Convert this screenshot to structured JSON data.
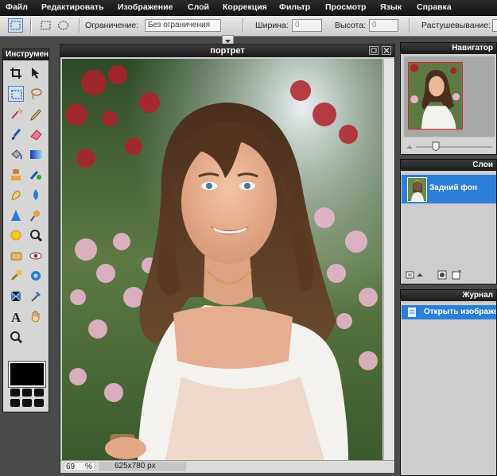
{
  "menu": {
    "items": [
      "Файл",
      "Редактировать",
      "Изображение",
      "Слой",
      "Коррекция",
      "Фильтр",
      "Просмотр",
      "Язык",
      "Справка"
    ]
  },
  "options_bar": {
    "constraint_label": "Ограничение:",
    "constraint_value": "Без ограничения",
    "width_label": "Ширина:",
    "width_value": "0",
    "height_label": "Высота:",
    "height_value": "0",
    "feather_label": "Растушевывание:"
  },
  "tools_panel": {
    "title": "Инструменты",
    "icons": [
      "crop-icon",
      "move-icon",
      "marquee-icon",
      "lasso-icon",
      "magic-wand-icon",
      "pencil-icon",
      "brush-icon",
      "eraser-icon",
      "paint-bucket-icon",
      "gradient-icon",
      "clone-stamp-icon",
      "color-replace-icon",
      "smudge-icon",
      "blur-icon",
      "sharpen-icon",
      "dodge-icon",
      "burn-icon",
      "zoom-icon",
      "sponge-icon",
      "red-eye-icon",
      "spot-heal-icon",
      "bloat-icon",
      "pinch-icon",
      "eyedropper-icon",
      "type-icon",
      "hand-icon",
      "zoom-out-icon"
    ],
    "primary_color": "#000000"
  },
  "document": {
    "title": "портрет",
    "zoom": "69",
    "zoom_unit": "%",
    "size": "625x780 px"
  },
  "navigator": {
    "title": "Навигатор"
  },
  "layers": {
    "title": "Слои",
    "items": [
      {
        "name": "Задний фон",
        "selected": true
      }
    ]
  },
  "history": {
    "title": "Журнал",
    "items": [
      {
        "name": "Открыть изображение",
        "selected": true
      }
    ]
  },
  "colors": {
    "accent": "#2c7fd8",
    "panel_header": "#1c1c1c",
    "workspace": "#4a4a4a"
  }
}
